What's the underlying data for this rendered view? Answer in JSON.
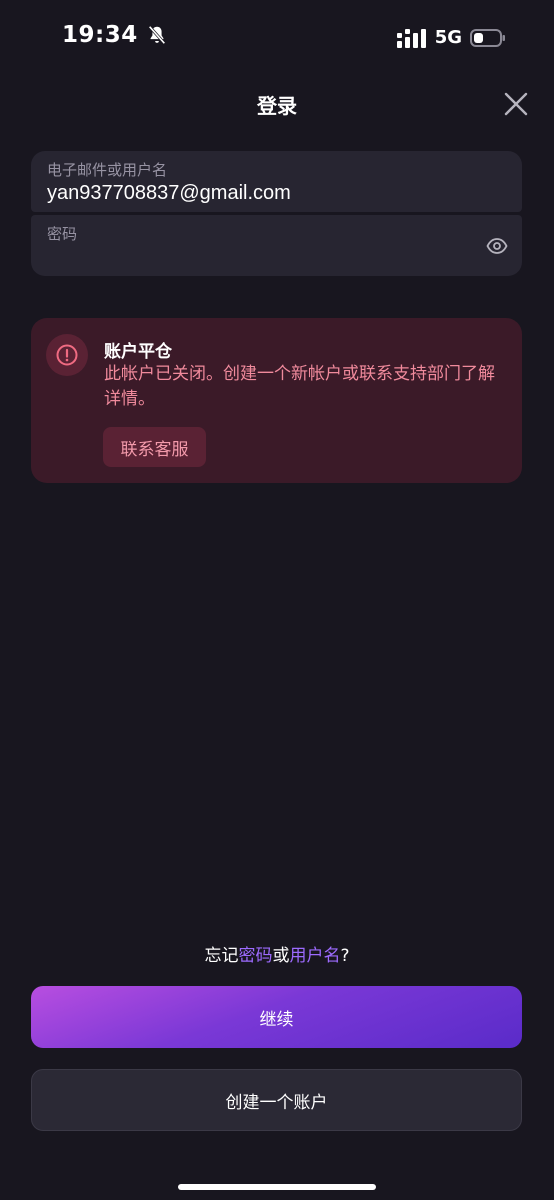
{
  "status_bar": {
    "time": "19:34",
    "network": "5G",
    "icons": [
      "bell-slash-icon",
      "signal-icon",
      "battery-icon"
    ]
  },
  "header": {
    "title": "登录",
    "close_icon": "close-icon"
  },
  "form": {
    "email_label": "电子邮件或用户名",
    "email_value": "yan937708837@gmail.com",
    "password_label": "密码",
    "password_value": "",
    "eye_icon": "eye-icon"
  },
  "alert": {
    "icon": "alert-circle-icon",
    "title": "账户平仓",
    "message": "此帐户已关闭。创建一个新帐户或联系支持部门了解详情。",
    "button_label": "联系客服"
  },
  "forgot": {
    "prefix": "忘记",
    "password_link": "密码",
    "or": "或",
    "username_link": "用户名",
    "suffix": "?"
  },
  "buttons": {
    "continue_label": "继续",
    "create_account_label": "创建一个账户"
  },
  "colors": {
    "background": "#18161f",
    "field_bg": "#272531",
    "alert_bg": "#3b1a28",
    "alert_text": "#f08a9c",
    "link": "#9d6bff",
    "primary_gradient_start": "#b84ee0",
    "primary_gradient_end": "#5a2bc9"
  }
}
